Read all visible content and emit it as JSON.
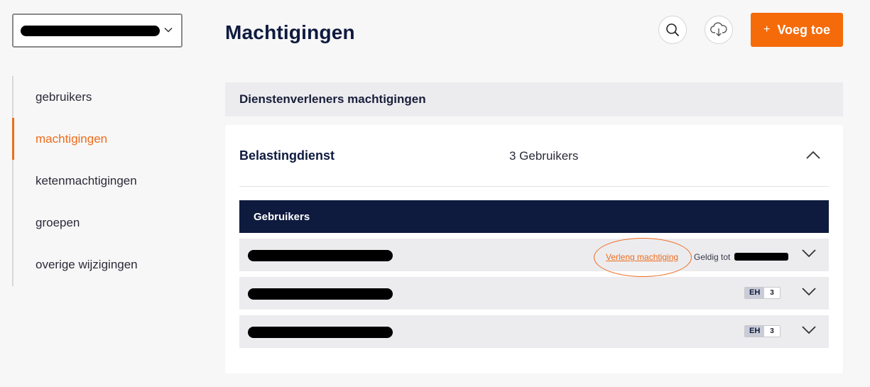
{
  "org_select": {
    "value": "",
    "chevron": "chevron-down-icon"
  },
  "sidebar": {
    "items": [
      {
        "label": "gebruikers",
        "active": false
      },
      {
        "label": "machtigingen",
        "active": true
      },
      {
        "label": "ketenmachtigingen",
        "active": false
      },
      {
        "label": "groepen",
        "active": false
      },
      {
        "label": "overige wijzigingen",
        "active": false
      }
    ]
  },
  "header": {
    "title": "Machtigingen",
    "search_icon": "search-icon",
    "download_icon": "cloud-download-icon",
    "add_button": {
      "icon": "+",
      "label": "Voeg toe"
    }
  },
  "section": {
    "title": "Dienstenverleners machtigingen"
  },
  "card": {
    "title": "Belastingdienst",
    "count": "3 Gebruikers",
    "users_header": "Gebruikers",
    "rows": [
      {
        "name": "",
        "action_link": "Verleng machtiging",
        "valid_label": "Geldig tot",
        "valid_date": ""
      },
      {
        "name": "",
        "badge_code": "EH",
        "badge_count": "3"
      },
      {
        "name": "",
        "badge_code": "EH",
        "badge_count": "3"
      }
    ]
  },
  "colors": {
    "accent": "#f56b0a",
    "navy": "#0f1a3f",
    "row_bg": "#ececef"
  }
}
